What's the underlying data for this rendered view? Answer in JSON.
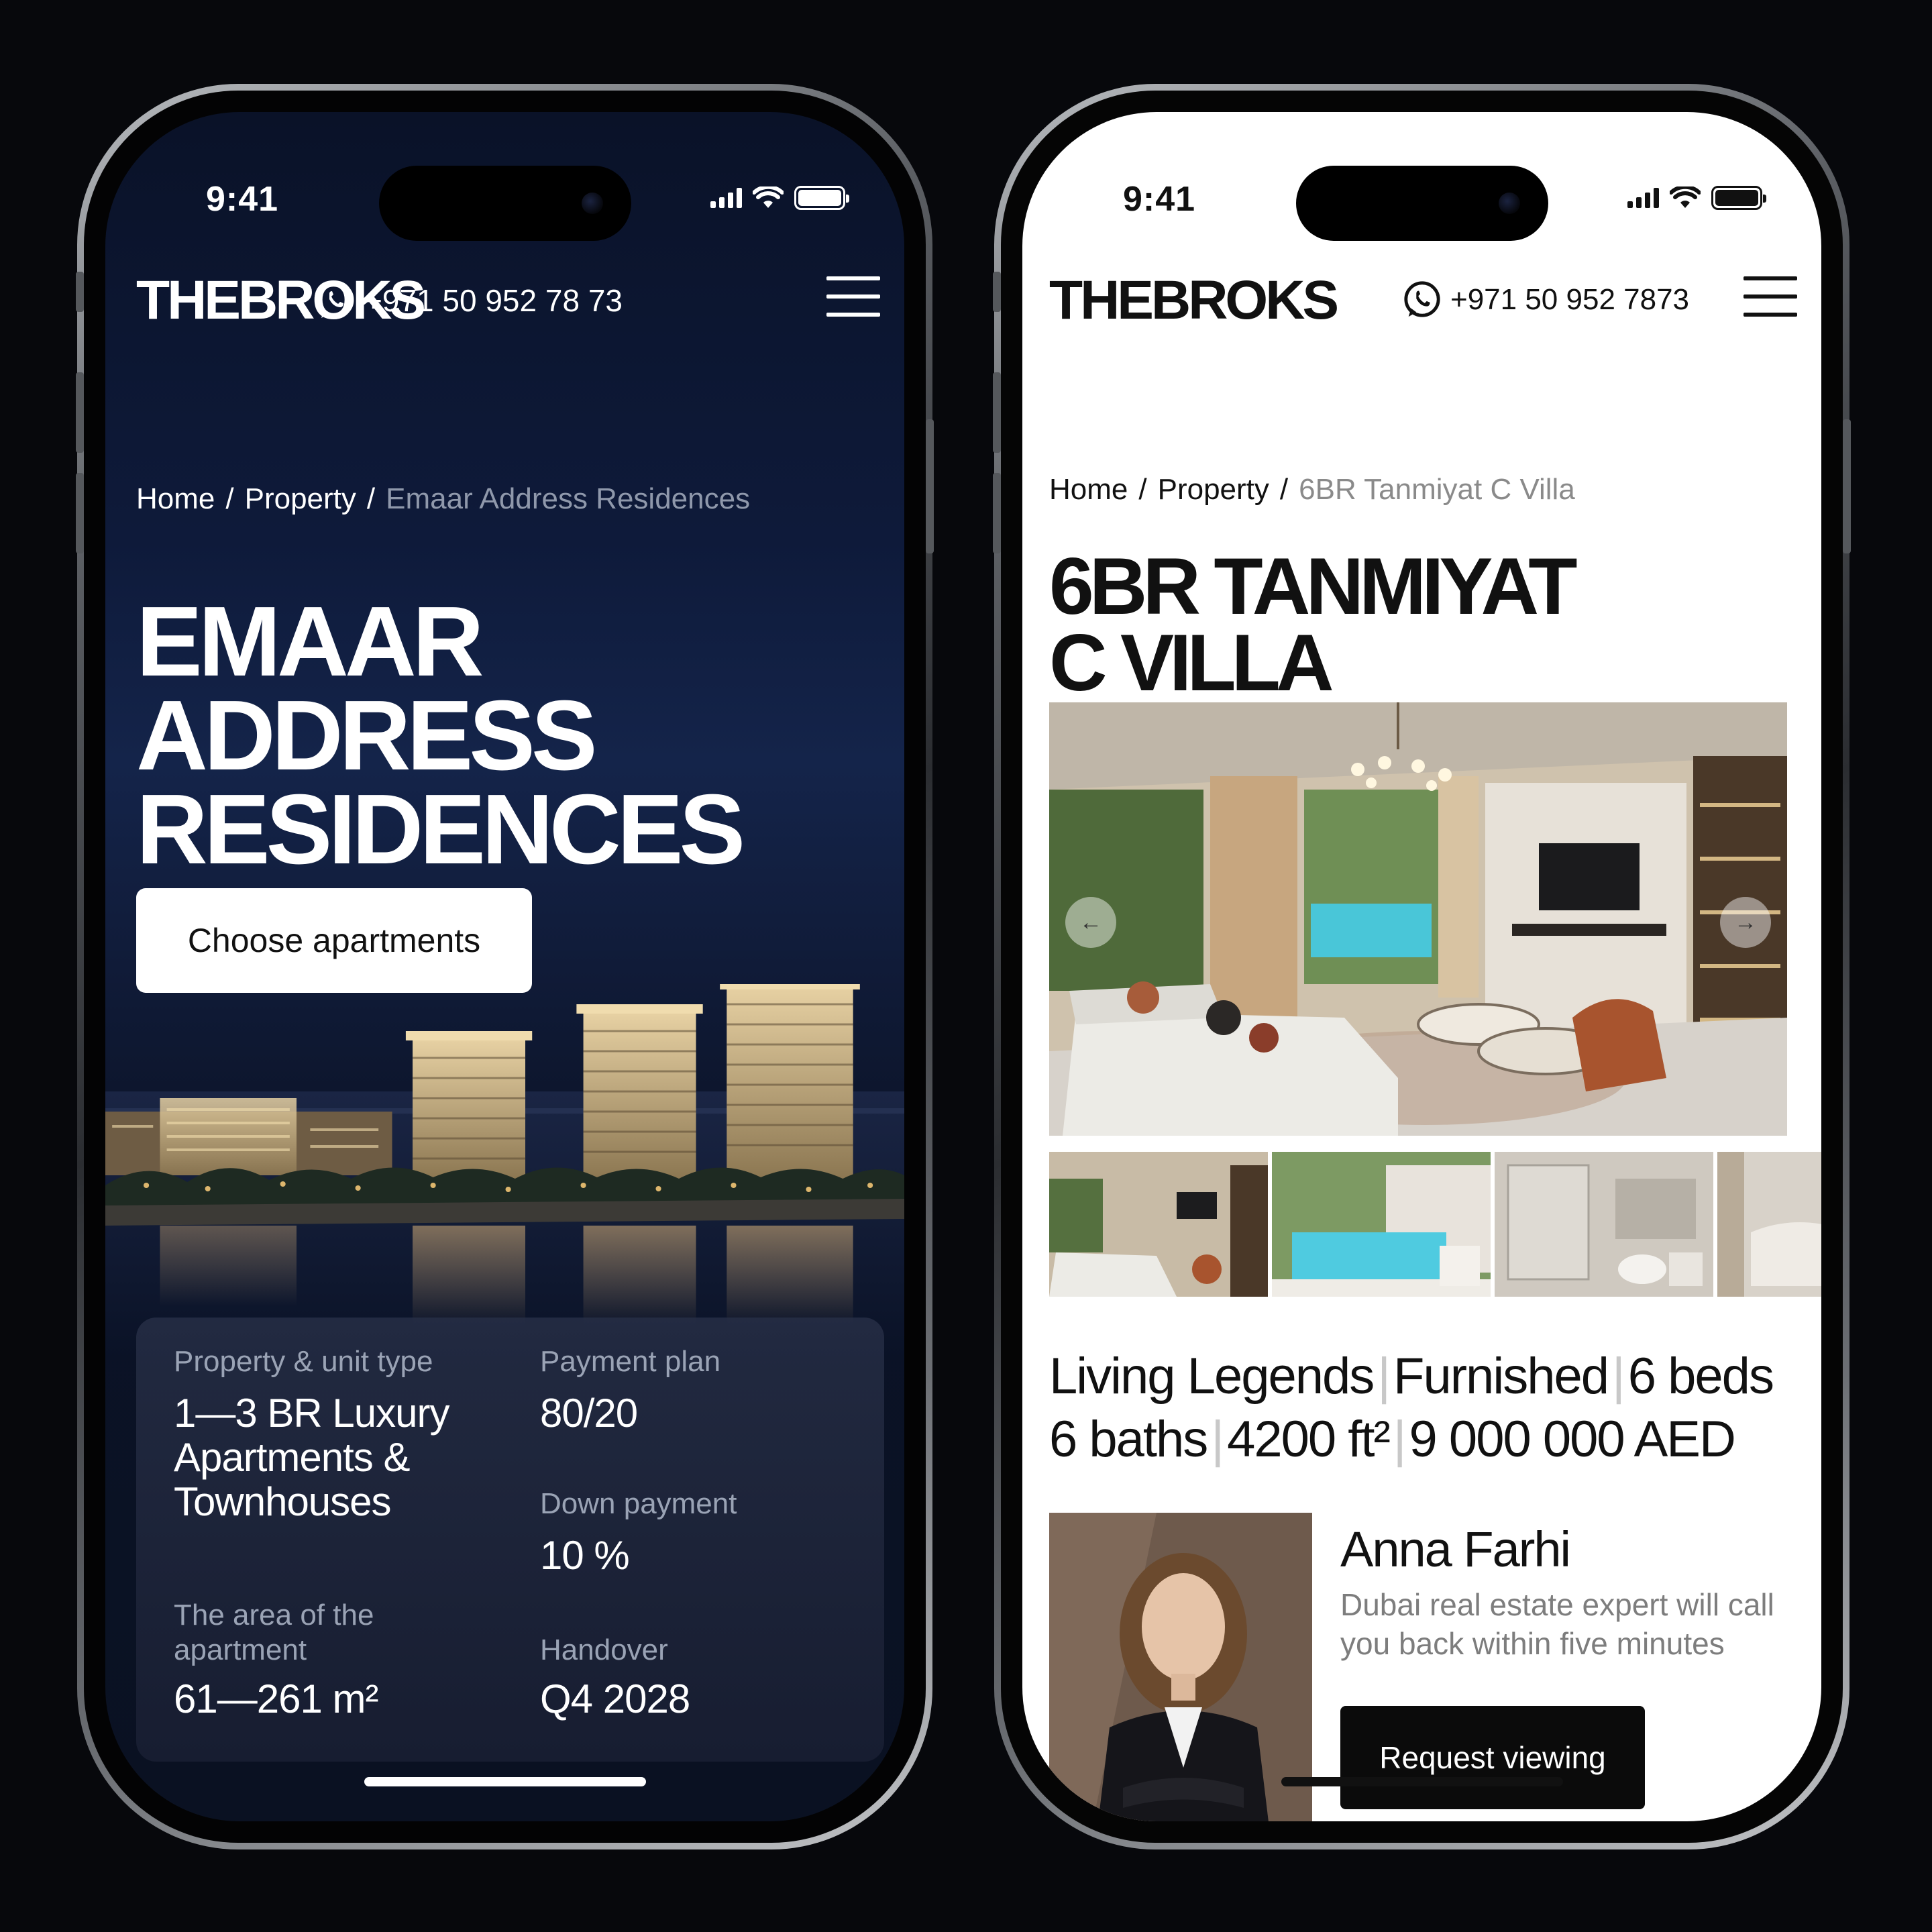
{
  "left_phone": {
    "status_bar": {
      "time": "9:41"
    },
    "header": {
      "logo": "THEBROKS",
      "phone": "+971 50 952 78 73"
    },
    "breadcrumb": {
      "home": "Home",
      "sep": "/",
      "property": "Property",
      "current": "Emaar Address Residences"
    },
    "hero": {
      "title_lines": [
        "EMAAR",
        "ADDRESS",
        "RESIDENCES"
      ],
      "cta": "Choose apartments"
    },
    "details": {
      "unit_type": {
        "label": "Property & unit type",
        "value_lines": [
          "1—3 BR Luxury",
          "Apartments &",
          "Townhouses"
        ]
      },
      "payment_plan": {
        "label": "Payment plan",
        "value": "80/20"
      },
      "down_payment": {
        "label": "Down payment",
        "value": "10 %"
      },
      "area": {
        "label_lines": [
          "The area of the",
          "apartment"
        ],
        "value": "61—261 m²"
      },
      "handover": {
        "label": "Handover",
        "value": "Q4 2028"
      }
    }
  },
  "right_phone": {
    "status_bar": {
      "time": "9:41"
    },
    "header": {
      "logo": "THEBROKS",
      "phone": "+971 50 952 7873"
    },
    "breadcrumb": {
      "home": "Home",
      "sep": "/",
      "property": "Property",
      "current": "6BR Tanmiyat C Villa"
    },
    "title_lines": [
      "6BR TANMIYAT",
      "C VILLA"
    ],
    "gallery": {
      "prev_icon": "arrow-left-icon",
      "next_icon": "arrow-right-icon",
      "thumb_count": 4
    },
    "specs": {
      "line1": [
        "Living Legends",
        "Furnished",
        "6 beds"
      ],
      "line2": [
        "6 baths",
        "4200 ft²",
        "9 000 000 AED"
      ],
      "separator": "|"
    },
    "agent": {
      "name": "Anna Farhi",
      "description": "Dubai real estate expert will call you back within five minutes",
      "cta": "Request viewing"
    }
  }
}
